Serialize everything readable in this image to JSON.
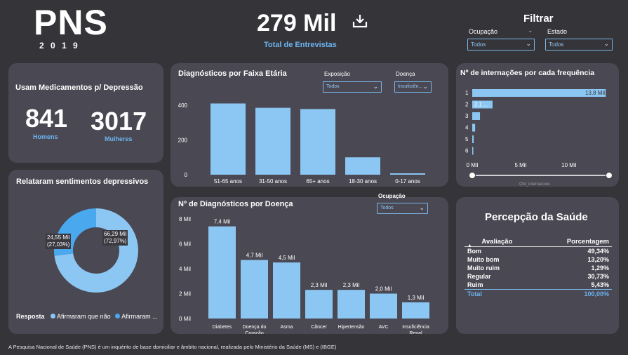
{
  "header": {
    "logo_title": "PNS",
    "logo_year": "2 0 1 9",
    "total_value": "279 Mil",
    "total_label": "Total de Entrevistas",
    "download_icon": "download-icon",
    "filter_title": "Filtrar",
    "filter_ocupacao_label": "Ocupação",
    "filter_ocupacao_value": "Todos",
    "filter_estado_label": "Estado",
    "filter_estado_value": "Todos"
  },
  "medicamentos": {
    "title": "Usam Medicamentos p/ Depressão",
    "homens_value": "841",
    "homens_label": "Homens",
    "mulheres_value": "3017",
    "mulheres_label": "Mulheres"
  },
  "sentimentos": {
    "title": "Relataram sentimentos depressivos",
    "legend_title": "Resposta",
    "legend_items": [
      "Afirmaram que não",
      "Afirmaram ..."
    ],
    "label_small_1": "24,55 Mil",
    "label_small_2": "(27,03%)",
    "label_big_1": "66,29 Mil",
    "label_big_2": "(72,97%)",
    "colors": {
      "nao": "#8cc6f2",
      "sim": "#49a8ee"
    }
  },
  "faixa": {
    "title": "Diagnósticos por Faixa Etária",
    "exposicao_label": "Exposição",
    "exposicao_value": "Todos",
    "doenca_label": "Doença",
    "doenca_value": "Insuficiên..."
  },
  "internacoes": {
    "title": "Nº de internações por cada frequência",
    "bar_label_1": "13,8 Mil",
    "bar_label_2": "2,1 ...",
    "slider_label": "Qtd_internacoes"
  },
  "doencas": {
    "title": "Nº de Diagnósticos por Doença",
    "ocupacao_label": "Ocupação",
    "ocupacao_value": "Todos"
  },
  "percepcao": {
    "title": "Percepção da Saúde",
    "col_avaliacao": "Avaliação",
    "col_porcentagem": "Porcentagem",
    "rows": [
      {
        "avaliacao": "Bom",
        "pct": "49,34%"
      },
      {
        "avaliacao": "Muito bom",
        "pct": "13,20%"
      },
      {
        "avaliacao": "Muito ruim",
        "pct": "1,29%"
      },
      {
        "avaliacao": "Regular",
        "pct": "30,73%"
      },
      {
        "avaliacao": "Ruim",
        "pct": "5,43%"
      }
    ],
    "total_label": "Total",
    "total_value": "100,00%"
  },
  "footer": {
    "text": "A Pesquisa Nacional de Saúde (PNS) é um inquérito de base domiciliar e âmbito nacional, realizada pelo Ministério da Saúde (MS) e (IBGE)"
  },
  "chart_data": [
    {
      "type": "bar",
      "title": "Diagnósticos por Faixa Etária",
      "categories": [
        "51-65 anos",
        "31-50 anos",
        "65+ anos",
        "18-30 anos",
        "0-17 anos"
      ],
      "values": [
        410,
        385,
        378,
        100,
        8
      ],
      "yticks": [
        "0",
        "200",
        "400"
      ],
      "ylim": [
        0,
        420
      ],
      "color": "#8cc6f2"
    },
    {
      "type": "bar",
      "orientation": "horizontal",
      "title": "Nº de internações por cada frequência",
      "categories": [
        "1",
        "2",
        "3",
        "4",
        "5",
        "6"
      ],
      "values": [
        13.8,
        2.1,
        0.8,
        0.3,
        0.15,
        0.08
      ],
      "xticks": [
        "0 Mil",
        "5 Mil",
        "10 Mil"
      ],
      "xlim": [
        0,
        14
      ],
      "color": "#8cc6f2"
    },
    {
      "type": "bar",
      "title": "Nº de Diagnósticos por Doença",
      "categories": [
        "Diabetes",
        "Doença do Coração",
        "Asma",
        "Câncer",
        "Hipertensão",
        "AVC",
        "Insuficiência Renal"
      ],
      "values": [
        7.4,
        4.7,
        4.5,
        2.3,
        2.3,
        2.0,
        1.3
      ],
      "data_labels": [
        "7,4 Mil",
        "4,7 Mil",
        "4,5 Mil",
        "2,3 Mil",
        "2,3 Mil",
        "2,0 Mil",
        "1,3 Mil"
      ],
      "yticks": [
        "0 Mil",
        "2 Mil",
        "4 Mil",
        "6 Mil",
        "8 Mil"
      ],
      "ylim": [
        0,
        8
      ],
      "color": "#8cc6f2"
    },
    {
      "type": "pie",
      "title": "Relataram sentimentos depressivos",
      "categories": [
        "Afirmaram que não",
        "Afirmaram ..."
      ],
      "values": [
        66.29,
        24.55
      ]
    }
  ]
}
